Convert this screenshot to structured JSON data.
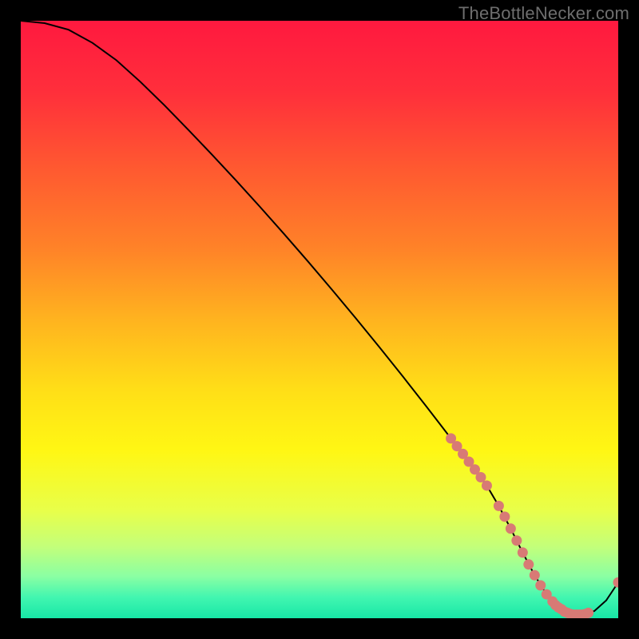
{
  "watermark": "TheBottleNecker.com",
  "gradient": {
    "stops": [
      {
        "offset": 0.0,
        "color": "#ff193f"
      },
      {
        "offset": 0.12,
        "color": "#ff2f3b"
      },
      {
        "offset": 0.25,
        "color": "#ff5a30"
      },
      {
        "offset": 0.38,
        "color": "#ff8228"
      },
      {
        "offset": 0.5,
        "color": "#ffb31f"
      },
      {
        "offset": 0.62,
        "color": "#ffdf17"
      },
      {
        "offset": 0.72,
        "color": "#fff714"
      },
      {
        "offset": 0.82,
        "color": "#e8ff4a"
      },
      {
        "offset": 0.88,
        "color": "#c3ff7a"
      },
      {
        "offset": 0.93,
        "color": "#8affa3"
      },
      {
        "offset": 0.965,
        "color": "#42f6b0"
      },
      {
        "offset": 1.0,
        "color": "#17e7a7"
      }
    ]
  },
  "chart_data": {
    "type": "line",
    "title": "",
    "xlabel": "",
    "ylabel": "",
    "x_range": [
      0,
      100
    ],
    "y_range": [
      0,
      100
    ],
    "series": [
      {
        "name": "bottleneck-curve",
        "x": [
          0,
          4,
          8,
          12,
          16,
          20,
          24,
          28,
          32,
          36,
          40,
          44,
          48,
          52,
          56,
          60,
          64,
          68,
          70,
          72,
          74,
          76,
          78,
          80,
          82,
          84,
          86,
          88,
          90,
          92,
          94,
          96,
          98,
          100
        ],
        "y": [
          100,
          99.6,
          98.5,
          96.3,
          93.4,
          89.8,
          85.9,
          81.8,
          77.6,
          73.3,
          68.9,
          64.4,
          59.8,
          55.1,
          50.3,
          45.4,
          40.4,
          35.3,
          32.7,
          30.1,
          27.5,
          24.9,
          22.2,
          18.8,
          15.0,
          11.0,
          7.2,
          4.0,
          1.8,
          0.7,
          0.6,
          1.2,
          3.0,
          6.0
        ]
      }
    ],
    "highlight_points": {
      "name": "highlighted-region",
      "color": "#d87a75",
      "points": [
        {
          "x": 72,
          "y": 30.1
        },
        {
          "x": 73,
          "y": 28.8
        },
        {
          "x": 74,
          "y": 27.5
        },
        {
          "x": 75,
          "y": 26.2
        },
        {
          "x": 76,
          "y": 24.9
        },
        {
          "x": 77,
          "y": 23.6
        },
        {
          "x": 78,
          "y": 22.2
        },
        {
          "x": 80,
          "y": 18.8
        },
        {
          "x": 81,
          "y": 17.0
        },
        {
          "x": 82,
          "y": 15.0
        },
        {
          "x": 83,
          "y": 13.0
        },
        {
          "x": 84,
          "y": 11.0
        },
        {
          "x": 85,
          "y": 9.0
        },
        {
          "x": 86,
          "y": 7.2
        },
        {
          "x": 87,
          "y": 5.5
        },
        {
          "x": 88,
          "y": 4.0
        },
        {
          "x": 89,
          "y": 2.8
        },
        {
          "x": 89.5,
          "y": 2.2
        },
        {
          "x": 90,
          "y": 1.8
        },
        {
          "x": 90.5,
          "y": 1.5
        },
        {
          "x": 91,
          "y": 1.1
        },
        {
          "x": 91.5,
          "y": 0.9
        },
        {
          "x": 92,
          "y": 0.7
        },
        {
          "x": 92.5,
          "y": 0.6
        },
        {
          "x": 93,
          "y": 0.6
        },
        {
          "x": 93.5,
          "y": 0.6
        },
        {
          "x": 94,
          "y": 0.6
        },
        {
          "x": 94.5,
          "y": 0.7
        },
        {
          "x": 95,
          "y": 0.9
        },
        {
          "x": 100,
          "y": 6.0
        }
      ]
    }
  }
}
